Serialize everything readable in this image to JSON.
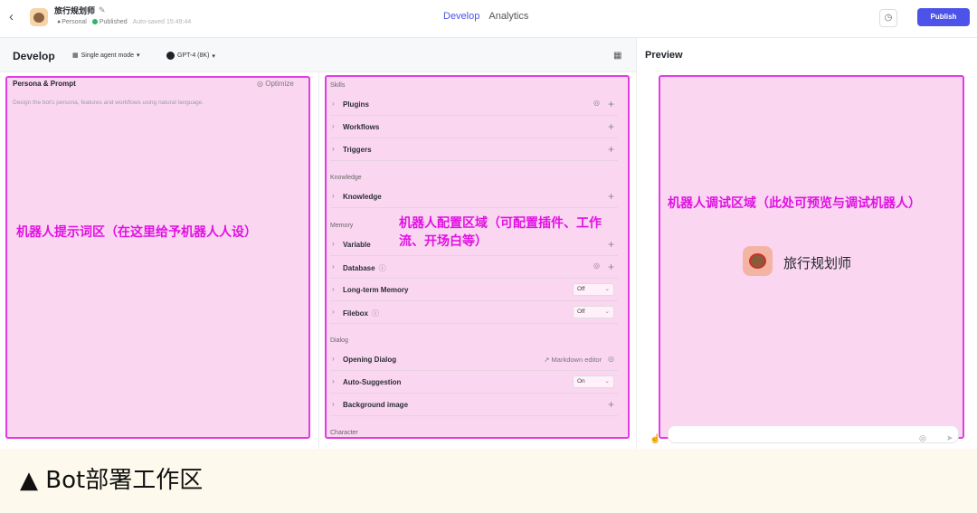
{
  "topbar": {
    "back_icon": "chevron-left-icon",
    "bot_name": "旅行规划师",
    "edit_icon": "edit-icon",
    "owner": "Personal",
    "status": "Published",
    "status_color": "#2bb665",
    "autosave": "Auto-saved 15:49:44",
    "tabs": [
      {
        "label": "Develop",
        "active": true
      },
      {
        "label": "Analytics",
        "active": false
      }
    ],
    "history_icon": "clock-icon",
    "publish_label": "Publish",
    "accent": "#4d53e8"
  },
  "develop": {
    "title": "Develop",
    "mode": "Single agent mode",
    "model": "GPT-4 (8K)",
    "layout_icon": "grid-icon"
  },
  "persona": {
    "title": "Persona & Prompt",
    "optimize_label": "Optimize",
    "placeholder": "Design the bot's persona, features and workflows using natural language."
  },
  "skills": {
    "sections": [
      {
        "label": "Skills",
        "items": [
          {
            "label": "Plugins",
            "control": "plus",
            "extra": "auto"
          },
          {
            "label": "Workflows",
            "control": "plus"
          },
          {
            "label": "Triggers",
            "control": "plus"
          }
        ]
      },
      {
        "label": "Knowledge",
        "items": [
          {
            "label": "Knowledge",
            "control": "plus"
          }
        ]
      },
      {
        "label": "Memory",
        "items": [
          {
            "label": "Variable",
            "control": "plus"
          },
          {
            "label": "Database",
            "control": "plus",
            "info": true,
            "extra": "auto"
          },
          {
            "label": "Long-term Memory",
            "control": "select",
            "value": "Off"
          },
          {
            "label": "Filebox",
            "control": "select",
            "value": "Off",
            "info": true
          }
        ]
      },
      {
        "label": "Dialog",
        "items": [
          {
            "label": "Opening Dialog",
            "control": "markdown",
            "value": "Markdown editor"
          },
          {
            "label": "Auto-Suggestion",
            "control": "select",
            "value": "On"
          },
          {
            "label": "Background image",
            "control": "plus"
          }
        ]
      },
      {
        "label": "Character",
        "items": []
      }
    ]
  },
  "preview": {
    "title": "Preview",
    "bot_name": "旅行规划师"
  },
  "annotations": {
    "left": "机器人提示词区（在这里给予机器人人设）",
    "mid": "机器人配置区域（可配置插件、工作流、开场白等）",
    "right": "机器人调试区域（此处可预览与调试机器人）",
    "highlight_color": "#e13de2"
  },
  "caption": "▲ Bot部署工作区"
}
